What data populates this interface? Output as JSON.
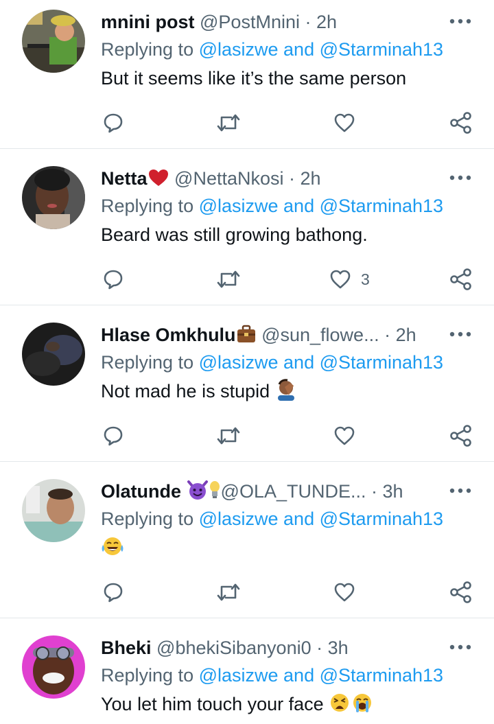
{
  "replies": [
    {
      "name": "mnini post",
      "handle": "@PostMnini",
      "separator": "·",
      "time": "2h",
      "replying_prefix": "Replying to ",
      "replying_to": "@lasizwe and @Starminah13",
      "text": "But it seems like it’s the same person",
      "like_count": "",
      "icons": {
        "reply": "reply-icon",
        "retweet": "retweet-icon",
        "like": "heart-icon",
        "share": "share-icon",
        "more": "more-icon"
      }
    },
    {
      "name": "Netta",
      "name_badge": "red-heart-emoji",
      "handle": "@NettaNkosi",
      "separator": "·",
      "time": "2h",
      "replying_prefix": "Replying to ",
      "replying_to": "@lasizwe and @Starminah13",
      "text": "Beard was still growing bathong.",
      "like_count": "3"
    },
    {
      "name": "Hlase Omkhulu",
      "name_badge": "briefcase-emoji",
      "handle": "@sun_flowe...",
      "separator": "·",
      "time": "2h",
      "replying_prefix": "Replying to ",
      "replying_to": "@lasizwe and @Starminah13",
      "text": "Not mad he is stupid",
      "text_emoji": "facepalm-emoji",
      "like_count": ""
    },
    {
      "name": "Olatunde",
      "name_badge": "smiling-devil-emoji",
      "name_badge_2": "light-bulb-emoji",
      "handle": "@OLA_TUNDE...",
      "separator": "·",
      "time": "3h",
      "replying_prefix": "Replying to ",
      "replying_to": "@lasizwe and @Starminah13",
      "text": "",
      "text_emoji": "tears-of-joy-emoji",
      "like_count": ""
    },
    {
      "name": "Bheki",
      "handle": "@bhekiSibanyoni0",
      "separator": "·",
      "time": "3h",
      "replying_prefix": "Replying to ",
      "replying_to": "@lasizwe and @Starminah13",
      "text": "You let him touch your face",
      "text_emoji": "weary-face-emoji",
      "text_emoji_2": "loudly-crying-emoji",
      "like_count": ""
    }
  ],
  "colors": {
    "link": "#1d9bf0",
    "secondary": "#536471",
    "primary": "#0f1419",
    "divider": "#e3e7ea"
  }
}
